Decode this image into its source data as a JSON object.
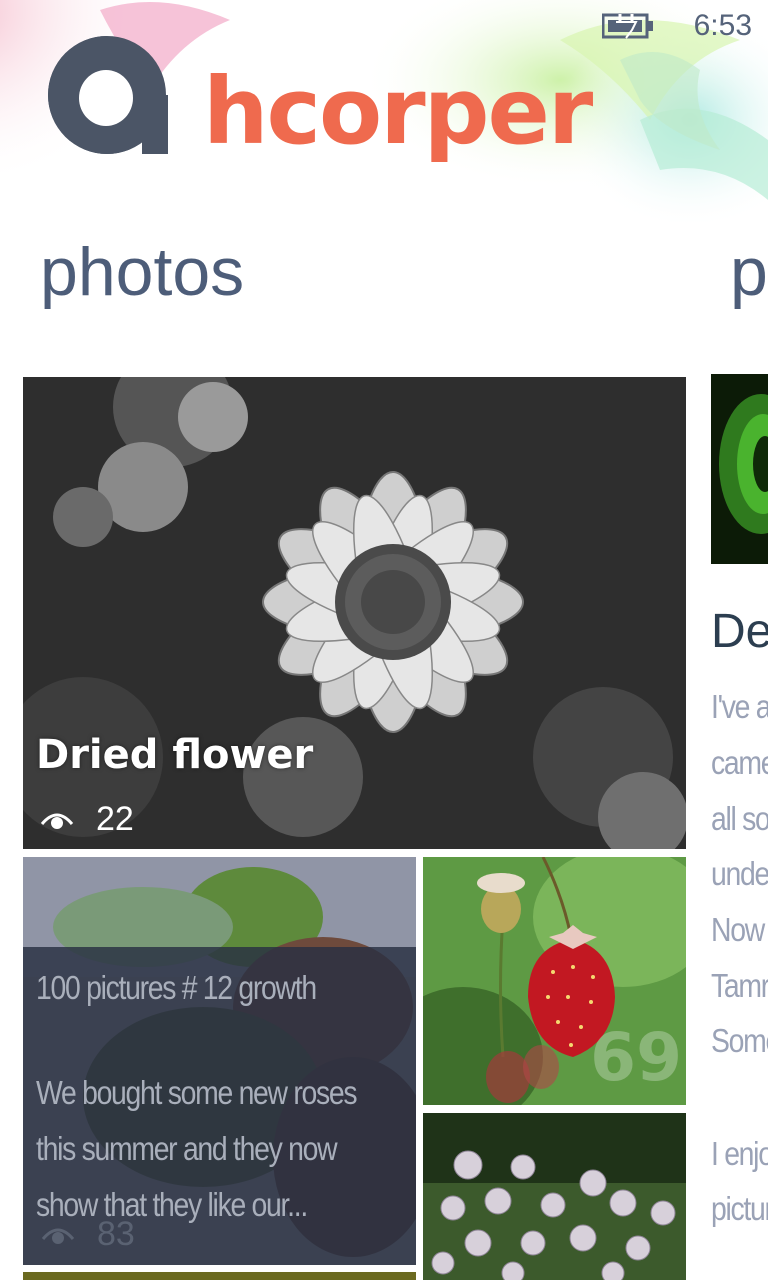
{
  "status_bar": {
    "time": "6:53",
    "battery_icon": "battery-charging-icon"
  },
  "header": {
    "logo_text": "hcorper",
    "logo_mark_icon": "logo-a-icon",
    "accent_color": "#ef6a4e"
  },
  "pivot": {
    "current_title": "photos",
    "next_title_peek": "p"
  },
  "photos": {
    "featured": {
      "title": "Dried flower",
      "views": "22",
      "views_icon": "eye-icon"
    },
    "growth": {
      "title": "100 pictures # 12 growth",
      "body": "We bought some new roses this summer and they now show that they like our...",
      "views": "83"
    },
    "strawberry": {
      "count_overlay": "69"
    }
  },
  "next_panel": {
    "heading": "De",
    "lines": [
      "I've a",
      "came",
      "all so",
      "under",
      "Now",
      "Tamr",
      "Some",
      "",
      "I enjo",
      "pictur"
    ]
  }
}
